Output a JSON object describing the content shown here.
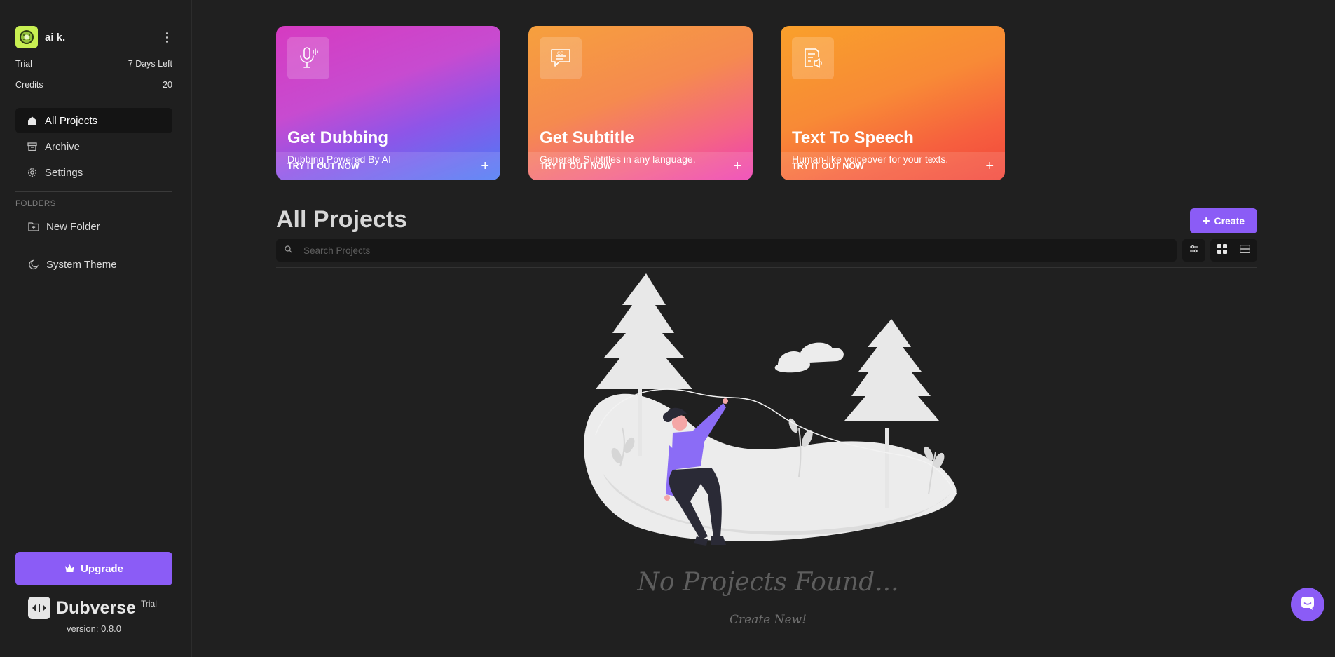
{
  "user": {
    "name": "ai k.",
    "avatar_icon": "kiwi-avatar-icon"
  },
  "account": {
    "plan_label": "Trial",
    "plan_value": "7 Days Left",
    "credits_label": "Credits",
    "credits_value": "20"
  },
  "sidebar": {
    "nav": [
      {
        "label": "All Projects",
        "icon": "home-icon",
        "active": true
      },
      {
        "label": "Archive",
        "icon": "archive-icon",
        "active": false
      },
      {
        "label": "Settings",
        "icon": "gear-icon",
        "active": false
      }
    ],
    "folders_label": "FOLDERS",
    "new_folder_label": "New Folder",
    "theme_label": "System Theme",
    "upgrade_label": "Upgrade"
  },
  "brand": {
    "name": "Dubverse",
    "badge": "Trial",
    "version": "version: 0.8.0"
  },
  "cards": [
    {
      "title": "Get Dubbing",
      "subtitle": "Dubbing Powered By AI",
      "cta": "TRY IT OUT NOW",
      "icon": "microphone-icon"
    },
    {
      "title": "Get Subtitle",
      "subtitle": "Generate Subtitles in any language.",
      "cta": "TRY IT OUT NOW",
      "icon": "subtitle-bubble-icon"
    },
    {
      "title": "Text To Speech",
      "subtitle": "Human-like voiceover for your texts.",
      "cta": "TRY IT OUT NOW",
      "icon": "document-speaker-icon"
    }
  ],
  "main": {
    "title": "All Projects",
    "create_label": "Create",
    "search_placeholder": "Search Projects",
    "empty_title": "No Projects Found...",
    "empty_subtitle": "Create New!"
  },
  "colors": {
    "accent": "#8b5cf6",
    "background": "#202020",
    "sidebar": "#1f1f1f"
  }
}
